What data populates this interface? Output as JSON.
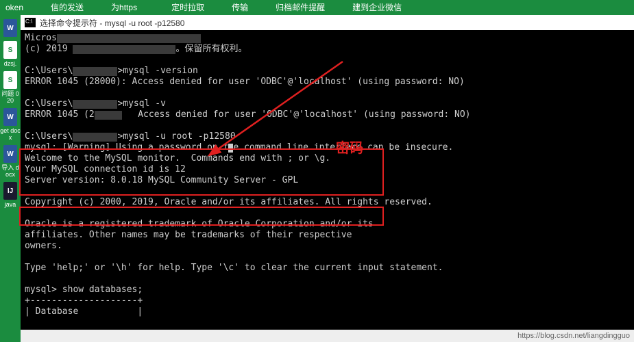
{
  "toolbar": {
    "tabs": [
      "oken",
      "信的发送",
      "为https",
      "定时拉取",
      "传输",
      "归档邮件提醒",
      "建到企业微信"
    ]
  },
  "files": [
    {
      "color": "blue",
      "letter": "W",
      "label": ""
    },
    {
      "color": "white",
      "letter": "S",
      "label": "dzsj."
    },
    {
      "color": "white",
      "letter": "S",
      "label": "问题\n020"
    },
    {
      "color": "blue",
      "letter": "W",
      "label": "get\ndocx"
    },
    {
      "color": "blue",
      "letter": "W",
      "label": "导入\ndocx"
    },
    {
      "color": "idea",
      "letter": "IJ",
      "label": "java"
    }
  ],
  "window": {
    "title": "选择命令提示符 - mysql  -u root -p12580"
  },
  "term": {
    "l1a": "Micros",
    "l2a": "(c) 2019 ",
    "l2b": "。保留所有权利。",
    "l3": "",
    "l4a": "C:\\Users\\",
    "l4b": ">mysql -version",
    "l5": "ERROR 1045 (28000): Access denied for user 'ODBC'@'localhost' (using password: NO)",
    "l6": "",
    "l7a": "C:\\Users\\",
    "l7b": ">mysql -v",
    "l8a": "ERROR 1045 (2",
    "l8b": "   Access denied for user 'ODBC'@'localhost' (using password: NO)",
    "l9": "",
    "l10a": "C:\\Users\\",
    "l10b": ">mysql -u root -p12580",
    "l11a": "mysql: [Warning] Using a password on t",
    "l11b": "e command line interface can be insecure.",
    "l12": "Welcome to the MySQL monitor.  Commands end with ; or \\g.",
    "l13": "Your MySQL connection id is 12",
    "l14": "Server version: 8.0.18 MySQL Community Server - GPL",
    "l15": "",
    "l16": "Copyright (c) 2000, 2019, Oracle and/or its affiliates. All rights reserved.",
    "l17": "",
    "l18": "Oracle is a registered trademark of Oracle Corporation and/or its",
    "l19": "affiliates. Other names may be trademarks of their respective",
    "l20": "owners.",
    "l21": "",
    "l22": "Type 'help;' or '\\h' for help. Type '\\c' to clear the current input statement.",
    "l23": "",
    "l24": "mysql> show databases;",
    "l25": "+--------------------+",
    "l26": "| Database           |"
  },
  "annot": {
    "password_label": "密码"
  },
  "watermark": "https://blog.csdn.net/liangdingguo"
}
